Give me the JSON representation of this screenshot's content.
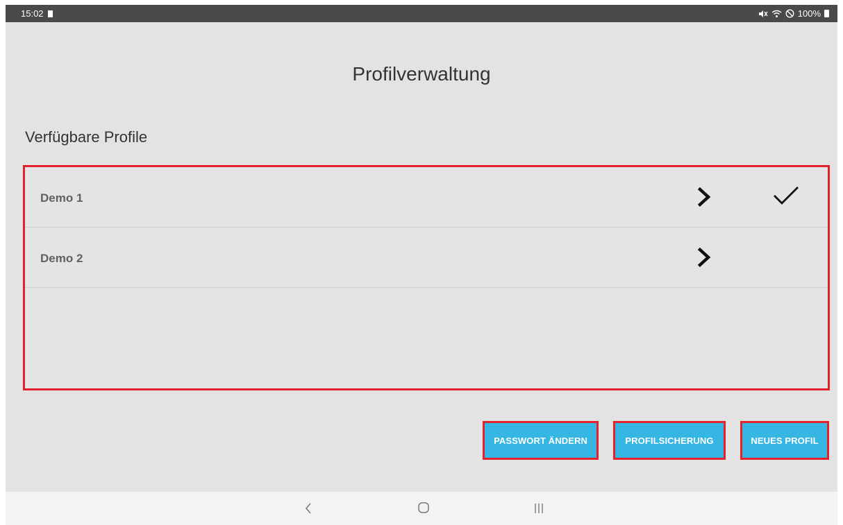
{
  "status_bar": {
    "time": "15:02",
    "battery_text": "100%",
    "icons": [
      "sim-icon",
      "mute-icon",
      "wifi-icon",
      "no-disturb-icon",
      "battery-icon"
    ]
  },
  "page": {
    "title": "Profilverwaltung",
    "section_label": "Verfügbare Profile"
  },
  "profiles": [
    {
      "name": "Demo 1",
      "active": true
    },
    {
      "name": "Demo 2",
      "active": false
    }
  ],
  "buttons": {
    "change_password": "PASSWORT ÄNDERN",
    "profile_backup": "PROFILSICHERUNG",
    "new_profile": "NEUES PROFIL"
  },
  "colors": {
    "highlight_border": "#e4202a",
    "button_bg": "#35b6e3",
    "status_bar_bg": "#4a4a4a",
    "screen_bg": "#e3e3e3"
  }
}
